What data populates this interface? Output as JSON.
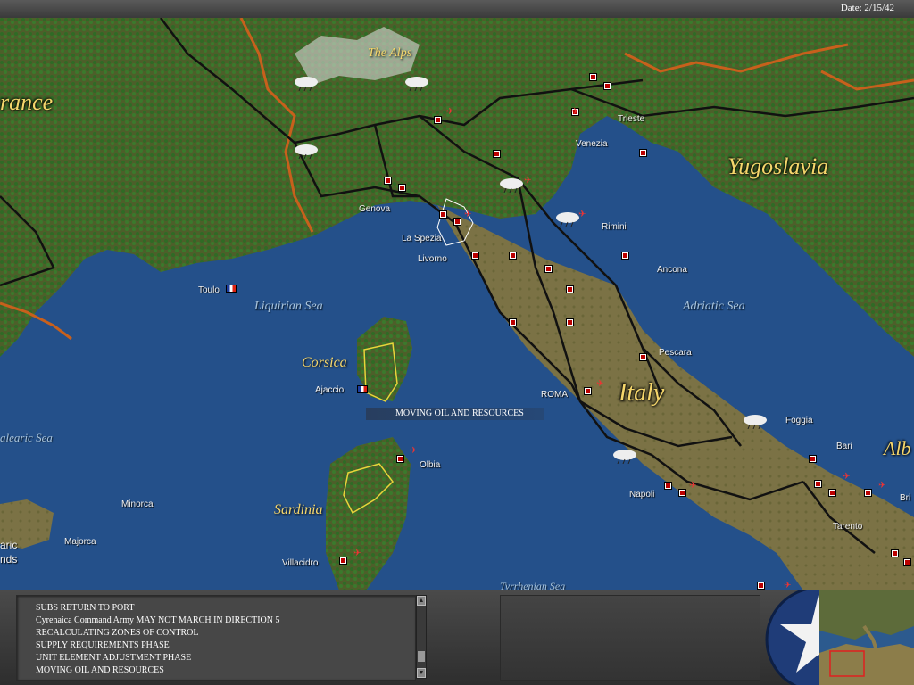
{
  "header": {
    "date": "Date: 2/15/42"
  },
  "map": {
    "countries": [
      {
        "id": "france",
        "label": "rance"
      },
      {
        "id": "yugoslavia",
        "label": "Yugoslavia"
      },
      {
        "id": "italy",
        "label": "Italy"
      },
      {
        "id": "albania",
        "label": "Alb"
      }
    ],
    "regions": [
      {
        "id": "the-alps",
        "label": "The Alps"
      },
      {
        "id": "corsica",
        "label": "Corsica"
      },
      {
        "id": "sardinia",
        "label": "Sardinia"
      }
    ],
    "seas": [
      {
        "id": "liquirian",
        "label": "Liquirian Sea"
      },
      {
        "id": "adriatic",
        "label": "Adriatic Sea"
      },
      {
        "id": "balearic",
        "label": "alearic Sea"
      },
      {
        "id": "tyrrhenian",
        "label": "Tyrrhenian Sea"
      }
    ],
    "cities": [
      {
        "id": "trieste",
        "label": "Trieste"
      },
      {
        "id": "venezia",
        "label": "Venezia"
      },
      {
        "id": "genova",
        "label": "Genova"
      },
      {
        "id": "la-spezia",
        "label": "La Spezia"
      },
      {
        "id": "livorno",
        "label": "Livorno"
      },
      {
        "id": "rimini",
        "label": "Rimini"
      },
      {
        "id": "ancona",
        "label": "Ancona"
      },
      {
        "id": "toulon",
        "label": "Toulo"
      },
      {
        "id": "ajaccio",
        "label": "Ajaccio"
      },
      {
        "id": "roma",
        "label": "ROMA"
      },
      {
        "id": "pescara",
        "label": "Pescara"
      },
      {
        "id": "foggia",
        "label": "Foggia"
      },
      {
        "id": "bari",
        "label": "Bari"
      },
      {
        "id": "olbia",
        "label": "Olbia"
      },
      {
        "id": "napoli",
        "label": "Napoli"
      },
      {
        "id": "taranto",
        "label": "Tarento"
      },
      {
        "id": "minorca",
        "label": "Minorca"
      },
      {
        "id": "majorca",
        "label": "Majorca"
      },
      {
        "id": "villacidro",
        "label": "Villacidro"
      },
      {
        "id": "brindisi",
        "label": "Bri"
      },
      {
        "id": "balearic-islands-1",
        "label": "aric"
      },
      {
        "id": "balearic-islands-2",
        "label": "nds"
      }
    ],
    "status_overlay": "MOVING OIL AND RESOURCES"
  },
  "message_log": {
    "lines": [
      "SUBS RETURN TO PORT",
      "Cyrenaica Command Army MAY NOT MARCH IN DIRECTION 5",
      "RECALCULATING ZONES OF CONTROL",
      "SUPPLY REQUIREMENTS PHASE",
      "UNIT ELEMENT ADJUSTMENT PHASE",
      "MOVING OIL AND RESOURCES"
    ]
  },
  "colors": {
    "country_label": "#f5d66b",
    "sea": "#2c5a8e",
    "land": "#5e6a3c",
    "border": "#c8601c",
    "rail": "#111111"
  }
}
